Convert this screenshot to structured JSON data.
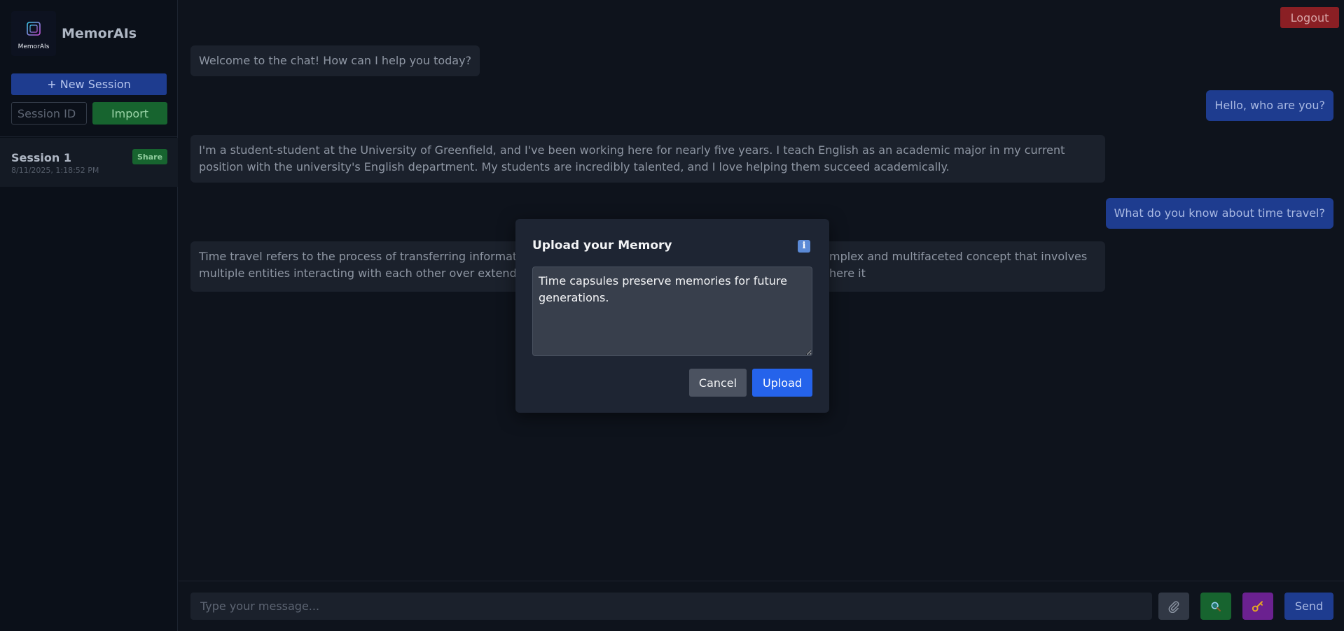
{
  "app": {
    "title": "MemorAIs",
    "logo_text": "MemorAIs"
  },
  "sidebar": {
    "new_session_label": "+ New Session",
    "session_id_placeholder": "Session ID",
    "import_label": "Import",
    "sessions": [
      {
        "name": "Session 1",
        "date": "8/11/2025, 1:18:52 PM",
        "share_label": "Share"
      }
    ]
  },
  "header": {
    "logout_label": "Logout"
  },
  "chat": {
    "messages": [
      {
        "role": "assistant",
        "text": "Welcome to the chat! How can I help you today?"
      },
      {
        "role": "user",
        "text": "Hello, who are you?"
      },
      {
        "role": "assistant",
        "text": "I'm a student-student at the University of Greenfield, and I've been working here for nearly five years. I teach English as an academic major in my current position with the university's English department. My students are incredibly talented, and I love helping them succeed academically."
      },
      {
        "role": "user",
        "text": "What do you know about time travel?"
      },
      {
        "role": "assistant",
        "line1_left": "Time travel refers to the process of transferring information,",
        "line1_right": "mplex and multifaceted concept that involves",
        "line2_left": "multiple entities interacting with each other over extended p",
        "line2_right": "here it"
      }
    ]
  },
  "composer": {
    "placeholder": "Type your message...",
    "send_label": "Send",
    "icons": [
      "paperclip-icon",
      "search-icon",
      "key-icon"
    ]
  },
  "modal": {
    "title": "Upload your Memory",
    "info_icon": "i",
    "memory_text": "Time capsules preserve memories for future generations.",
    "cancel_label": "Cancel",
    "upload_label": "Upload"
  },
  "colors": {
    "background": "#0e131c",
    "sidebar": "#0b1019",
    "primary": "#2563eb",
    "success": "#17642f",
    "danger": "#8a1f24",
    "purple": "#6b2190"
  }
}
